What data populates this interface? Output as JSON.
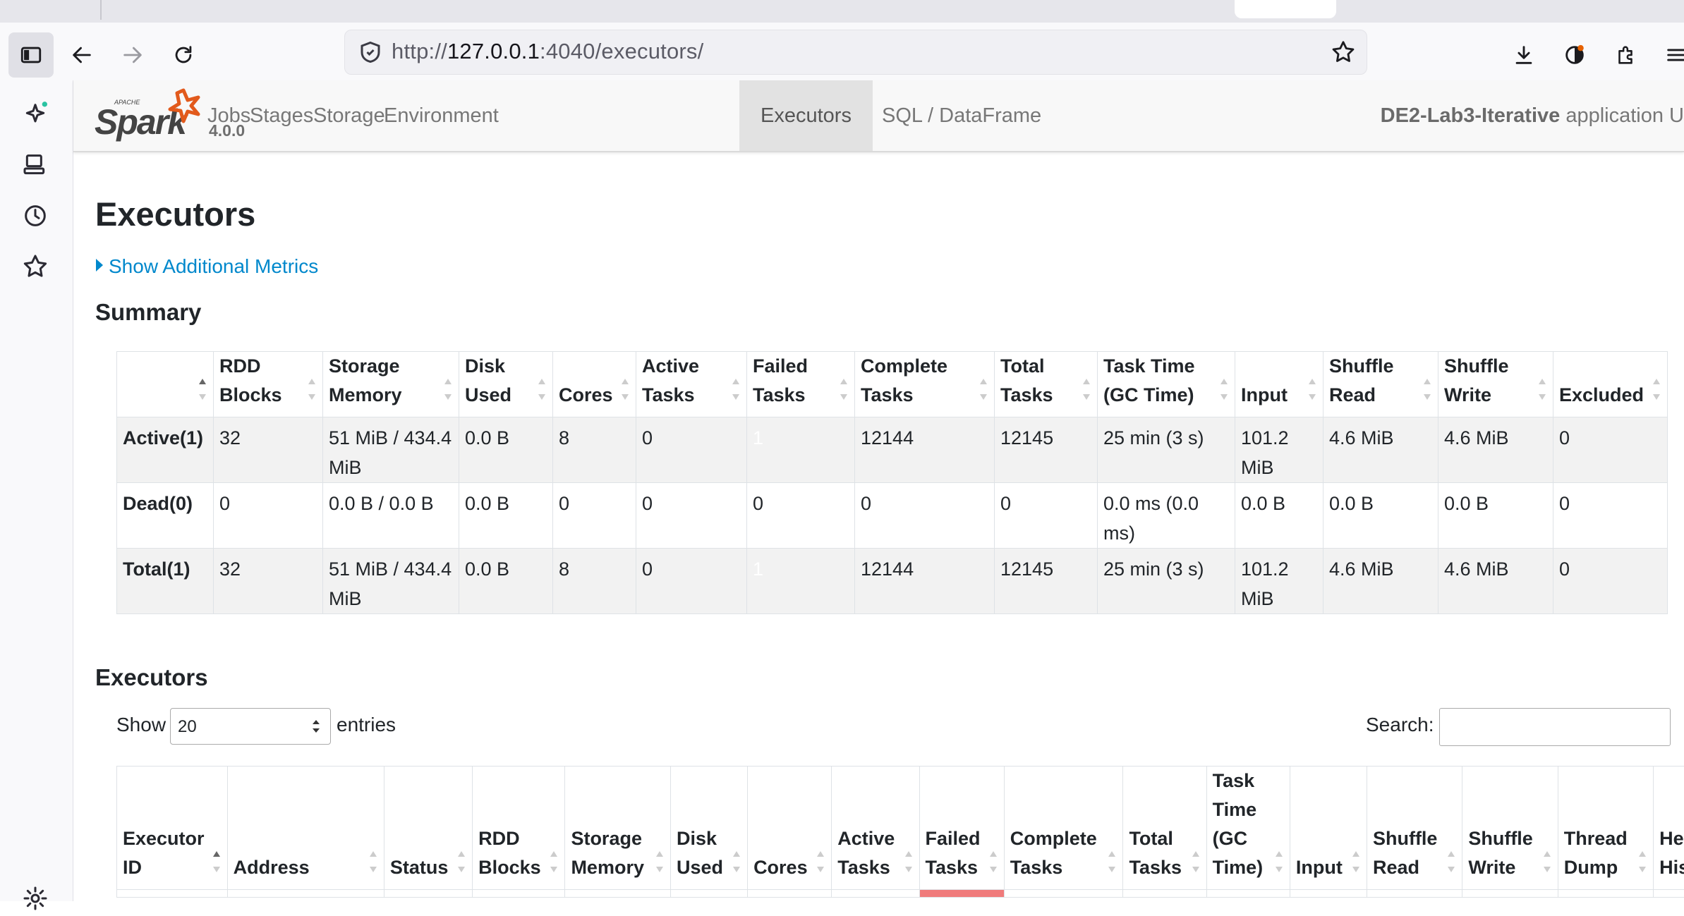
{
  "browser": {
    "url_prefix": "http://",
    "url_host": "127.0.0.1",
    "url_path": ":4040/executors/"
  },
  "spark": {
    "version": "4.0.0",
    "nav": [
      "Jobs",
      "Stages",
      "Storage",
      "Environment",
      "Executors",
      "SQL / DataFrame"
    ],
    "active_nav": "Executors",
    "app_name": "DE2-Lab3-Iterative",
    "app_suffix": "application U"
  },
  "page": {
    "title": "Executors",
    "show_metrics": "Show Additional Metrics",
    "summary_heading": "Summary",
    "executors_heading": "Executors"
  },
  "summary": {
    "headers": [
      "",
      "RDD Blocks",
      "Storage Memory",
      "Disk Used",
      "Cores",
      "Active Tasks",
      "Failed Tasks",
      "Complete Tasks",
      "Total Tasks",
      "Task Time (GC Time)",
      "Input",
      "Shuffle Read",
      "Shuffle Write",
      "Excluded"
    ],
    "rows": [
      [
        "Active(1)",
        "32",
        "51 MiB / 434.4 MiB",
        "0.0 B",
        "8",
        "0",
        "1",
        "12144",
        "12145",
        "25 min (3 s)",
        "101.2 MiB",
        "4.6 MiB",
        "4.6 MiB",
        "0"
      ],
      [
        "Dead(0)",
        "0",
        "0.0 B / 0.0 B",
        "0.0 B",
        "0",
        "0",
        "0",
        "0",
        "0",
        "0.0 ms (0.0 ms)",
        "0.0 B",
        "0.0 B",
        "0.0 B",
        "0"
      ],
      [
        "Total(1)",
        "32",
        "51 MiB / 434.4 MiB",
        "0.0 B",
        "8",
        "0",
        "1",
        "12144",
        "12145",
        "25 min (3 s)",
        "101.2 MiB",
        "4.6 MiB",
        "4.6 MiB",
        "0"
      ]
    ],
    "failed_highlight_color": "#f07b7b"
  },
  "executors_table": {
    "show_label": "Show",
    "entries_value": "20",
    "entries_label": "entries",
    "search_label": "Search:",
    "headers": [
      "Executor ID",
      "Address",
      "Status",
      "RDD Blocks",
      "Storage Memory",
      "Disk Used",
      "Cores",
      "Active Tasks",
      "Failed Tasks",
      "Complete Tasks",
      "Total Tasks",
      "Task Time (GC Time)",
      "Input",
      "Shuffle Read",
      "Shuffle Write",
      "Thread Dump",
      "Heap Histo"
    ]
  },
  "colors": {
    "link": "#0088cc",
    "nav_bg": "#f8f8f8",
    "nav_active_bg": "#e2e2e2"
  }
}
